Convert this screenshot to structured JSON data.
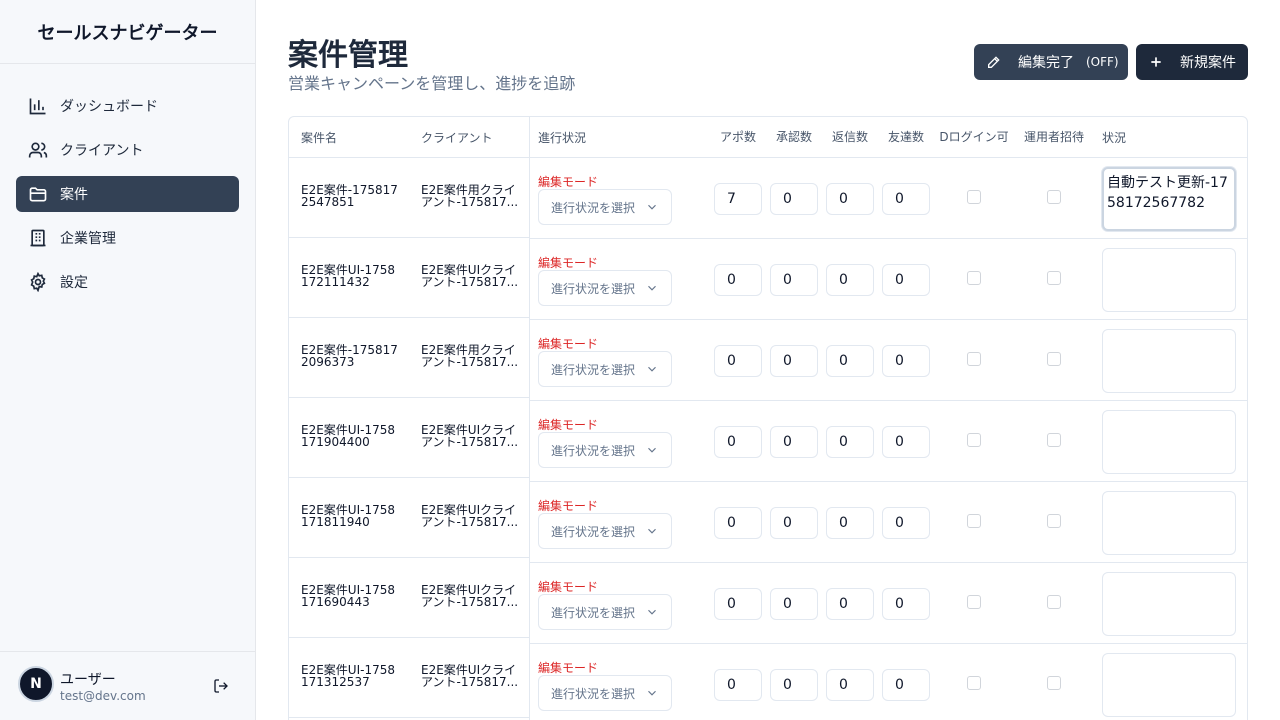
{
  "app": {
    "title": "セールスナビゲーター"
  },
  "sidebar": {
    "items": [
      {
        "label": "ダッシュボード",
        "icon": "chart-icon"
      },
      {
        "label": "クライアント",
        "icon": "users-icon"
      },
      {
        "label": "案件",
        "icon": "folder-icon"
      },
      {
        "label": "企業管理",
        "icon": "building-icon"
      },
      {
        "label": "設定",
        "icon": "gear-icon"
      }
    ],
    "active_index": 2
  },
  "user": {
    "name": "ユーザー",
    "email": "test@dev.com",
    "avatar_letter": "N"
  },
  "header": {
    "title": "案件管理",
    "subtitle": "営業キャンペーンを管理し、進捗を追跡",
    "edit_button": "編集完了",
    "edit_state": "(OFF)",
    "new_button": "新規案件"
  },
  "table": {
    "columns": {
      "name": "案件名",
      "client": "クライアント",
      "progress": "進行状況",
      "appo": "アポ数",
      "approval": "承認数",
      "reply": "返信数",
      "friend": "友達数",
      "dlogin": "Dログイン可",
      "operator": "運用者招待",
      "status": "状況"
    },
    "edit_mode_label": "編集モード",
    "select_placeholder": "進行状況を選択",
    "rows": [
      {
        "name": "E2E案件-1758172547851",
        "client": "E2E案件用クライアント-175817...",
        "appo": "7",
        "approval": "0",
        "reply": "0",
        "friend": "0",
        "status": "自動テスト更新-1758172567782"
      },
      {
        "name": "E2E案件UI-1758172111432",
        "client": "E2E案件UIクライアント-175817...",
        "appo": "0",
        "approval": "0",
        "reply": "0",
        "friend": "0",
        "status": ""
      },
      {
        "name": "E2E案件-1758172096373",
        "client": "E2E案件用クライアント-175817...",
        "appo": "0",
        "approval": "0",
        "reply": "0",
        "friend": "0",
        "status": ""
      },
      {
        "name": "E2E案件UI-1758171904400",
        "client": "E2E案件UIクライアント-175817...",
        "appo": "0",
        "approval": "0",
        "reply": "0",
        "friend": "0",
        "status": ""
      },
      {
        "name": "E2E案件UI-1758171811940",
        "client": "E2E案件UIクライアント-175817...",
        "appo": "0",
        "approval": "0",
        "reply": "0",
        "friend": "0",
        "status": ""
      },
      {
        "name": "E2E案件UI-1758171690443",
        "client": "E2E案件UIクライアント-175817...",
        "appo": "0",
        "approval": "0",
        "reply": "0",
        "friend": "0",
        "status": ""
      },
      {
        "name": "E2E案件UI-1758171312537",
        "client": "E2E案件UIクライアント-175817...",
        "appo": "0",
        "approval": "0",
        "reply": "0",
        "friend": "0",
        "status": ""
      }
    ]
  }
}
